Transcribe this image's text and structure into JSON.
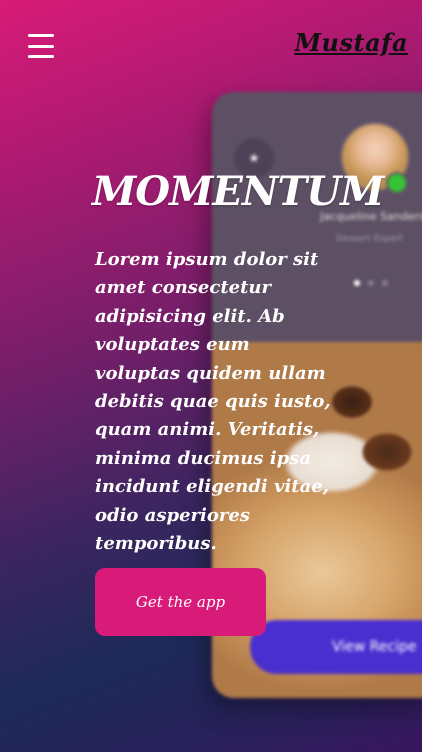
{
  "header": {
    "menu_icon": "hamburger-menu-icon",
    "logo_text": "Mustafa"
  },
  "hero": {
    "title": "MOMENTUM",
    "description": "Lorem ipsum dolor sit amet consectetur adipisicing elit. Ab voluptates eum voluptas quidem ullam debitis quae quis iusto, quam animi. Veritatis, minima ducimus ipsa incidunt eligendi vitae, odio asperiores temporibus.",
    "cta_label": "Get the app"
  },
  "phone_mockup": {
    "chef_name": "Jacqueline Sanders",
    "chef_role": "Dessert Expert",
    "carousel_dots": 3,
    "active_dot": 1,
    "recipe_button_label": "View Recipe",
    "back_icon": "star-icon"
  },
  "colors": {
    "accent": "#d81b78",
    "recipe_button": "#4a2fd0",
    "online_status": "#35c435"
  }
}
